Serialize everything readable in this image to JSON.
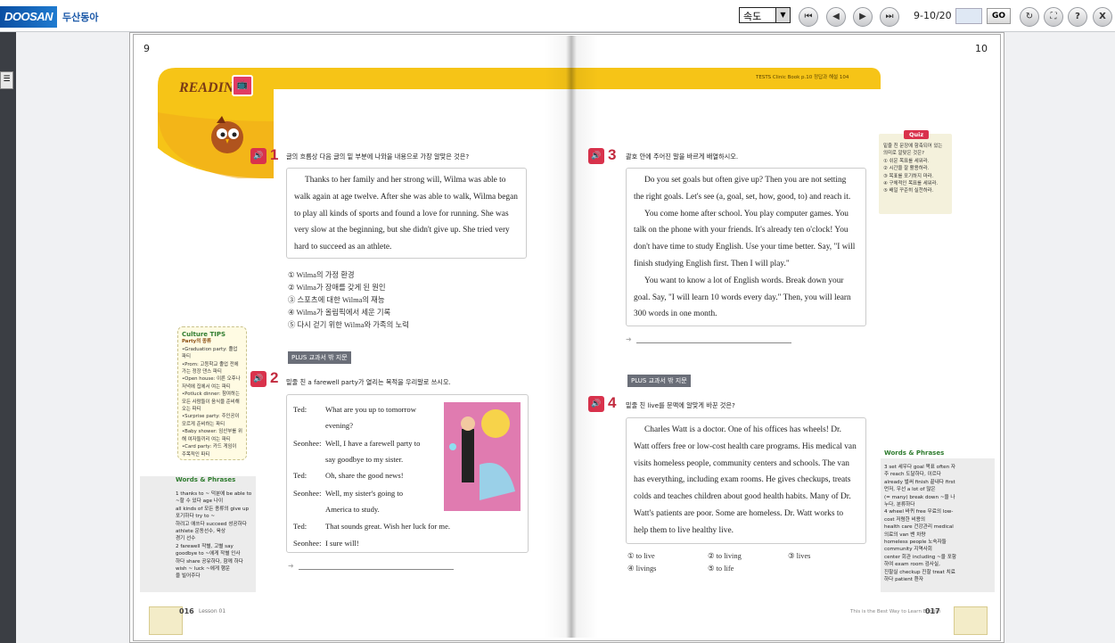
{
  "toolbar": {
    "logo": "DOOSAN",
    "brand": "두산동아",
    "speed_select": "속도",
    "page_indicator": "9-10/20",
    "go_label": "GO",
    "buttons": [
      "first-page",
      "prev-page",
      "next-page",
      "last-page"
    ],
    "close_label": "X",
    "help_label": "?"
  },
  "book": {
    "left_page_number": "9",
    "right_page_number": "10",
    "reading_badge": "READING",
    "header_right": "TESTS Clinic Book p.10  정답과 해설 104",
    "footer_left_page": "016",
    "footer_left_lesson": "Lesson 01",
    "footer_right_text": "This is the Best Way to Learn English",
    "footer_right_page": "017"
  },
  "q1": {
    "number": "1",
    "prompt": "글의 흐름상 다음 글의 밑 부분에 나와을 내용으로 가장 알맞은 것은?",
    "passage": [
      "Thanks to her family and her strong will, Wilma was able to",
      "walk again at age twelve. After she was able to walk, Wilma began",
      "to play all kinds of sports and found a love for running. She was",
      "very slow at the beginning, but she didn't give up. She tried very",
      "hard to succeed as an athlete."
    ],
    "options": [
      "① Wilma의 가정 환경",
      "② Wilma가 장애를 갖게 된 원인",
      "③ 스포츠에 대한 Wilma의 재능",
      "④ Wilma가 올림픽에서 세운 기록",
      "⑤ 다시 걷기 위한 Wilma와 가족의 노력"
    ]
  },
  "q2": {
    "plus": "PLUS 교과서 밖 지문",
    "number": "2",
    "prompt": "밑줄 친 a farewell party가 열리는 목적을 우리말로 쓰시오.",
    "dialogue": [
      {
        "speaker": "Ted:",
        "line": "What are you up to tomorrow"
      },
      {
        "speaker": "",
        "line": "evening?"
      },
      {
        "speaker": "Seonhee:",
        "line": "Well, I have a farewell party to"
      },
      {
        "speaker": "",
        "line": "say goodbye to my sister."
      },
      {
        "speaker": "Ted:",
        "line": "Oh, share the good news!"
      },
      {
        "speaker": "Seonhee:",
        "line": "Well, my sister's going to"
      },
      {
        "speaker": "",
        "line": "America to study."
      },
      {
        "speaker": "Ted:",
        "line": "That sounds great. Wish her luck for me."
      },
      {
        "speaker": "Seonhee:",
        "line": "I sure will!"
      }
    ]
  },
  "q3": {
    "number": "3",
    "prompt": "괄호 안에 주어진 말을 바르게 배열하시오.",
    "passage": [
      "Do you set goals but often give up? Then you are not setting",
      "the right goals. Let's see (a, goal, set, how, good, to) and reach it.",
      "You come home after school. You play computer games. You",
      "talk on the phone with your friends. It's already ten o'clock! You",
      "don't have time to study English. Use your time better. Say, \"I will",
      "finish studying English first. Then I will play.\"",
      "You want to know a lot of English words. Break down your",
      "goal. Say, \"I will learn 10 words every day.\" Then, you will learn",
      "300 words in one month."
    ]
  },
  "q4": {
    "plus": "PLUS 교과서 밖 지문",
    "number": "4",
    "prompt": "밑줄 친 live를 문맥에 알맞게 바꾼 것은?",
    "passage": [
      "Charles Watt is a doctor. One of his offices has wheels! Dr.",
      "Watt offers free or low-cost health care programs. His medical van",
      "visits homeless people, community centers and schools. The van",
      "has everything, including exam rooms. He gives checkups, treats",
      "colds and teaches children about good health habits. Many of Dr.",
      "Watt's patients are poor. Some are homeless. Dr. Watt works to",
      "help them to live healthy live."
    ],
    "options": [
      "① to live",
      "② to living",
      "③ lives",
      "④ livings",
      "⑤ to life"
    ]
  },
  "quiz": {
    "title": "Quiz",
    "prompt": "밑줄 친 문장에 함축되어 있는 의미로 알맞은 것은?",
    "options": [
      "① 쉬운 목표를 세워라.",
      "② 시간을 잘 활용하라.",
      "③ 목표를 포기하지 마라.",
      "④ 구체적인 목표를 세워라.",
      "⑤ 배일 꾸준히 실천하라."
    ]
  },
  "culture_tips": {
    "title": "Culture TIPS",
    "subtitle": "Party의 종류",
    "items": [
      "•Graduation party: 졸업 파티",
      "•Prom: 고등학교 졸업 전에 가는 정장 댄스 파티",
      "•Open house: 이른 오후나 저녁에 집에서 여는 파티",
      "•Potluck dinner: 참여하는 모든 사람들이 음식을 준비해 오는 파티",
      "•Surprise party: 주인공이 모르게 준비하는 파티",
      "•Baby shower: 임산부를 위해 여자들끼리 여는 파티",
      "•Card party: 카드 게임이 주목적인 파티"
    ]
  },
  "words_left": {
    "title": "Words & Phrases",
    "lines": [
      "1 thanks to ~ 덕분에 be able to ~할 수 있다 age 나이",
      "all kinds of 모든 종류의 give up 포기하다 try to ~",
      "하려고 애쓰다 succeed 성공하다 athlete 운동선수, 육상",
      "경기 선수",
      "2 farewell 작별, 고별 say goodbye to ~에게 작별 인사",
      "하다 share 공유하다, 함께 하다 wish ~ luck ~에게 행운",
      "을 빌어주다"
    ]
  },
  "words_right": {
    "title": "Words & Phrases",
    "lines": [
      "3 set 세우다 goal 목표 often 자주 reach 도달하다, 이르다",
      "already 벌써 finish 끝내다 first 먼저, 우선 a lot of 많은",
      "(= many) break down ~을 나누다, 분류하다",
      "4 wheel 바퀴 free 무료의 low-cost 저렴한 비용의",
      "health care 건강관리 medical 의료의 van 밴 차량",
      "homeless people 노숙자들 community 지역사회",
      "center 회관 including ~을 포함하여 exam room 검사실,",
      "진찰실 checkup 진찰 treat 치료하다 patient 환자"
    ]
  }
}
